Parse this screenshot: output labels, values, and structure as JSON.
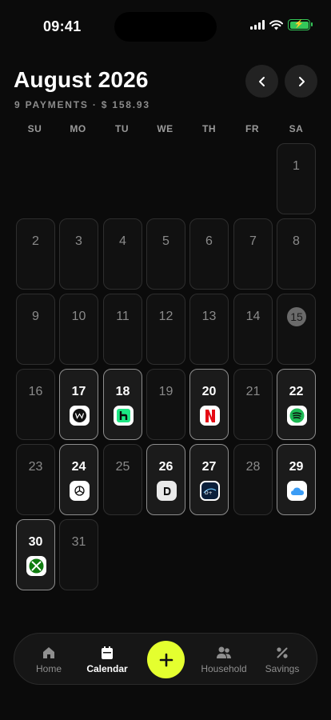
{
  "status_bar": {
    "time": "09:41"
  },
  "header": {
    "month_title": "August 2026",
    "summary": "9 PAYMENTS · $ 158.93"
  },
  "weekdays": [
    "SU",
    "MO",
    "TU",
    "WE",
    "TH",
    "FR",
    "SA"
  ],
  "calendar": {
    "today": "15",
    "days": [
      {
        "label": "1"
      },
      {
        "label": "2"
      },
      {
        "label": "3"
      },
      {
        "label": "4"
      },
      {
        "label": "5"
      },
      {
        "label": "6"
      },
      {
        "label": "7"
      },
      {
        "label": "8"
      },
      {
        "label": "9"
      },
      {
        "label": "10"
      },
      {
        "label": "11"
      },
      {
        "label": "12"
      },
      {
        "label": "13"
      },
      {
        "label": "14"
      },
      {
        "label": "15"
      },
      {
        "label": "16"
      },
      {
        "label": "17",
        "app": "webflow-icon"
      },
      {
        "label": "18",
        "app": "hulu-icon"
      },
      {
        "label": "19"
      },
      {
        "label": "20",
        "app": "netflix-icon"
      },
      {
        "label": "21"
      },
      {
        "label": "22",
        "app": "spotify-icon"
      },
      {
        "label": "23"
      },
      {
        "label": "24",
        "app": "chatgpt-icon"
      },
      {
        "label": "25"
      },
      {
        "label": "26",
        "app": "d-icon"
      },
      {
        "label": "27",
        "app": "disney-plus-icon"
      },
      {
        "label": "28"
      },
      {
        "label": "29",
        "app": "icloud-icon"
      },
      {
        "label": "30",
        "app": "xbox-icon"
      },
      {
        "label": "31"
      }
    ]
  },
  "tabbar": {
    "home": "Home",
    "calendar": "Calendar",
    "household": "Household",
    "savings": "Savings"
  },
  "colors": {
    "accent": "#e4ff2f",
    "netflix": "#e50914",
    "spotify": "#1db954",
    "hulu": "#1ce783",
    "xbox": "#107c10",
    "icloud": "#3b9cf5"
  }
}
